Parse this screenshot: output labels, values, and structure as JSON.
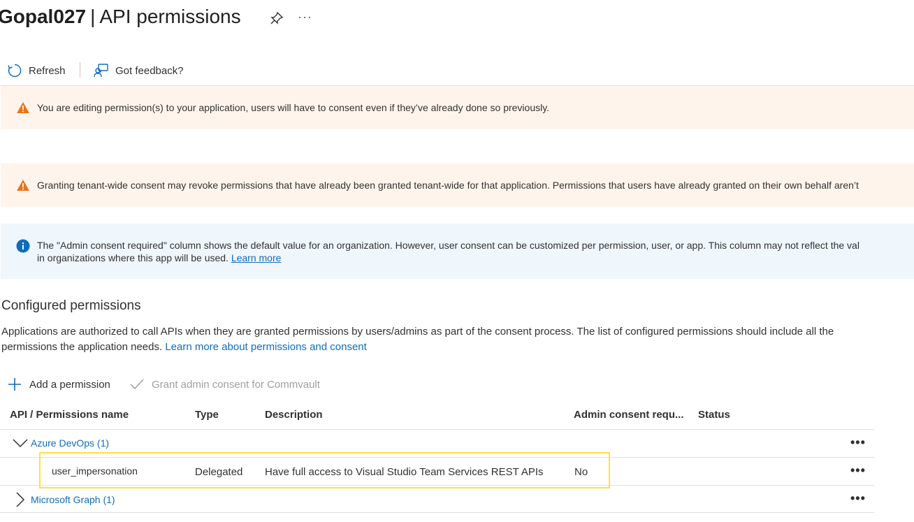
{
  "header": {
    "app_name": "Gopal027",
    "separator": "|",
    "page_title": "API permissions",
    "more_label": "···"
  },
  "toolbar": {
    "refresh_label": "Refresh",
    "feedback_label": "Got feedback?"
  },
  "banners": {
    "edit_warning": "You are editing permission(s) to your application, users will have to consent even if they’ve already done so previously.",
    "tenant_warning": "Granting tenant-wide consent may revoke permissions that have already been granted tenant-wide for that application. Permissions that users have already granted on their own behalf aren’t",
    "info_line1": "The \"Admin consent required\" column shows the default value for an organization. However, user consent can be customized per permission, user, or app. This column may not reflect the val",
    "info_line2": "in organizations where this app will be used.",
    "info_link": "Learn more"
  },
  "configured": {
    "title": "Configured permissions",
    "description": "Applications are authorized to call APIs when they are granted permissions by users/admins as part of the consent process. The list of configured permissions should include all the permissions the application needs.",
    "link": "Learn more about permissions and consent"
  },
  "actions": {
    "add_permission": "Add a permission",
    "grant_consent": "Grant admin consent for Commvault"
  },
  "table": {
    "columns": {
      "name": "API / Permissions name",
      "type": "Type",
      "description": "Description",
      "admin": "Admin consent requ...",
      "status": "Status"
    },
    "groups": [
      {
        "label": "Azure DevOps (1)",
        "permissions": [
          {
            "name": "user_impersonation",
            "type": "Delegated",
            "description": "Have full access to Visual Studio Team Services REST APIs",
            "admin": "No",
            "status": ""
          }
        ]
      },
      {
        "label": "Microsoft Graph (1)",
        "permissions": []
      }
    ],
    "row_menu": "•••"
  },
  "colors": {
    "accent": "#0f6cbd",
    "warning_bg": "#fff4ec",
    "warning_icon": "#e8751a",
    "info_bg": "#eff6fc",
    "info_icon": "#0f6cbd",
    "highlight": "#fde047"
  },
  "icons": [
    "pin-icon",
    "refresh-icon",
    "feedback-icon",
    "warning-icon",
    "info-icon",
    "plus-icon",
    "checkmark-icon",
    "chevron-down-icon",
    "chevron-right-icon",
    "more-icon"
  ]
}
